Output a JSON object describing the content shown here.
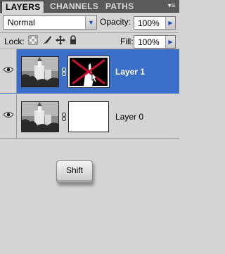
{
  "tabs": [
    {
      "label": "LAYERS",
      "active": true
    },
    {
      "label": "CHANNELS",
      "active": false
    },
    {
      "label": "PATHS",
      "active": false
    }
  ],
  "panel_menu_icon": "panel-menu-icon",
  "blend_mode": {
    "value": "Normal"
  },
  "opacity": {
    "label": "Opacity:",
    "value": "100%"
  },
  "lock": {
    "label": "Lock:",
    "icons": [
      "lock-transparency-icon",
      "lock-image-icon",
      "lock-position-icon",
      "lock-all-icon"
    ]
  },
  "fill": {
    "label": "Fill:",
    "value": "100%"
  },
  "layers": [
    {
      "name": "Layer 1",
      "selected": true,
      "visible": true,
      "mask": "black-with-red-x"
    },
    {
      "name": "Layer 0",
      "selected": false,
      "visible": true,
      "mask": "white"
    }
  ],
  "shift_key": {
    "label": "Shift"
  },
  "colors": {
    "panel_bg": "#d4d4d4",
    "tab_bar": "#5a5a5a",
    "selection": "#3b6ec6",
    "mask_x": "#c8102e"
  }
}
